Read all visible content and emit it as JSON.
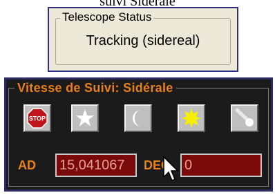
{
  "caption": "suivi Sidérale",
  "telescope_status": {
    "group_title": "Telescope Status",
    "value": "Tracking (sidereal)"
  },
  "tracking_speed": {
    "group_title": "Vitesse de Suivi: Sidérale",
    "buttons": [
      {
        "icon": "stop-sign-icon",
        "text": "STOP"
      },
      {
        "icon": "star-icon"
      },
      {
        "icon": "moon-icon"
      },
      {
        "icon": "sun-icon"
      },
      {
        "icon": "comet-icon"
      }
    ],
    "ra": {
      "label": "AD",
      "value": "15,041067"
    },
    "dec": {
      "label": "DEC",
      "value": "0"
    }
  },
  "colors": {
    "accent_orange": "#e8811a",
    "panel_background": "#1b1b1b",
    "field_background": "#7a0a0a",
    "field_text": "#e9a090",
    "sun_yellow": "#f7f000",
    "stop_red": "#c0161b"
  }
}
